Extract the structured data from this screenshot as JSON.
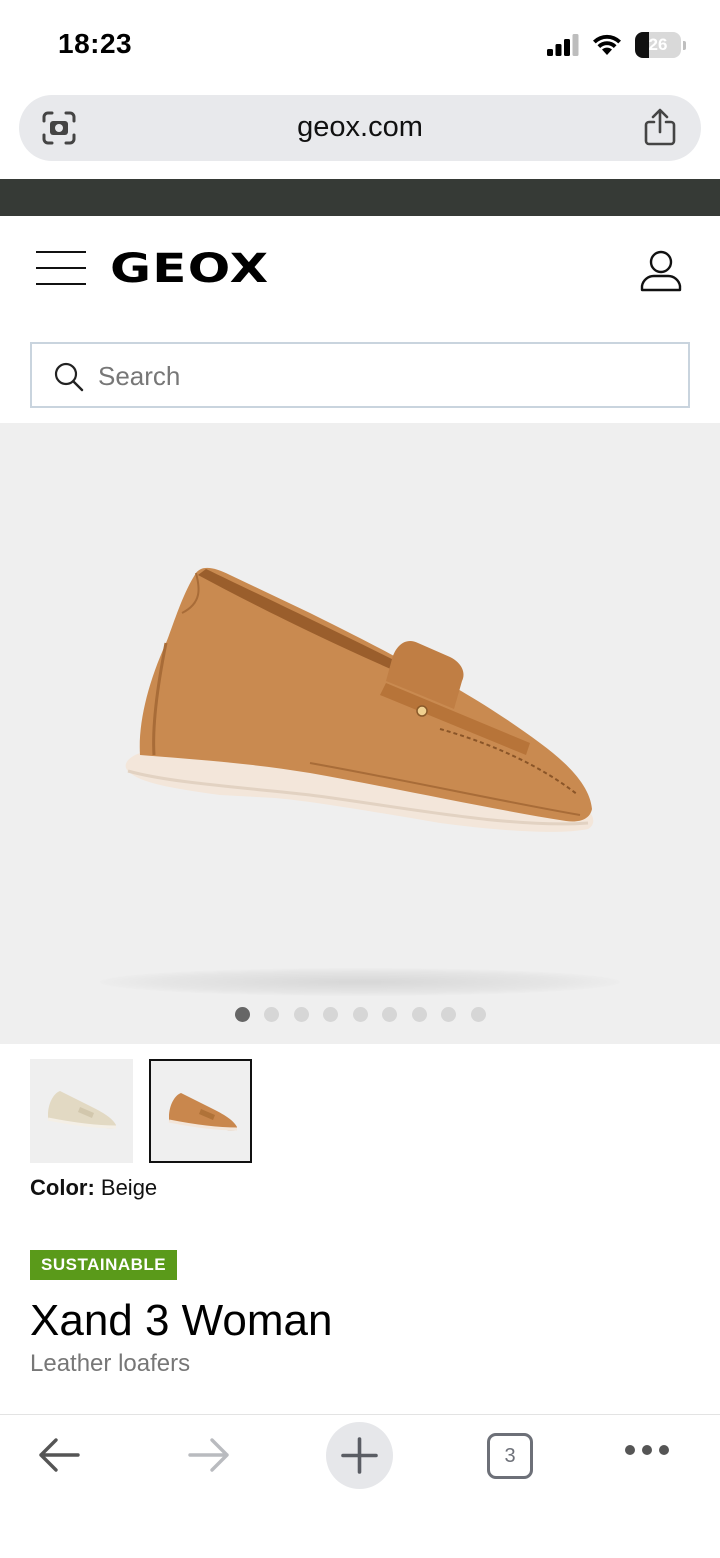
{
  "status_bar": {
    "time": "18:23",
    "battery_level": "26",
    "icons": [
      "signal-icon",
      "wifi-icon",
      "battery-icon"
    ]
  },
  "browser": {
    "url": "geox.com",
    "icons": [
      "camera-lens-icon",
      "share-icon"
    ]
  },
  "header": {
    "logo": "GEOX",
    "icons": [
      "hamburger-menu-icon",
      "account-icon"
    ]
  },
  "search": {
    "placeholder": "Search",
    "value": ""
  },
  "gallery": {
    "image_count": 9,
    "active_index": 0
  },
  "variants": {
    "color_label": "Color:",
    "color_value": "Beige",
    "thumbnails": [
      {
        "color": "#e2d9c3",
        "selected": false
      },
      {
        "color": "#c9874d",
        "selected": true
      }
    ]
  },
  "product": {
    "badge": "SUSTAINABLE",
    "badge_color": "#5a9a1a",
    "title": "Xand 3 Woman",
    "subtitle": "Leather loafers"
  },
  "toolbar": {
    "tab_count": "3",
    "icons": [
      "back-arrow-icon",
      "forward-arrow-icon",
      "plus-icon",
      "tabs-icon",
      "more-icon"
    ]
  }
}
